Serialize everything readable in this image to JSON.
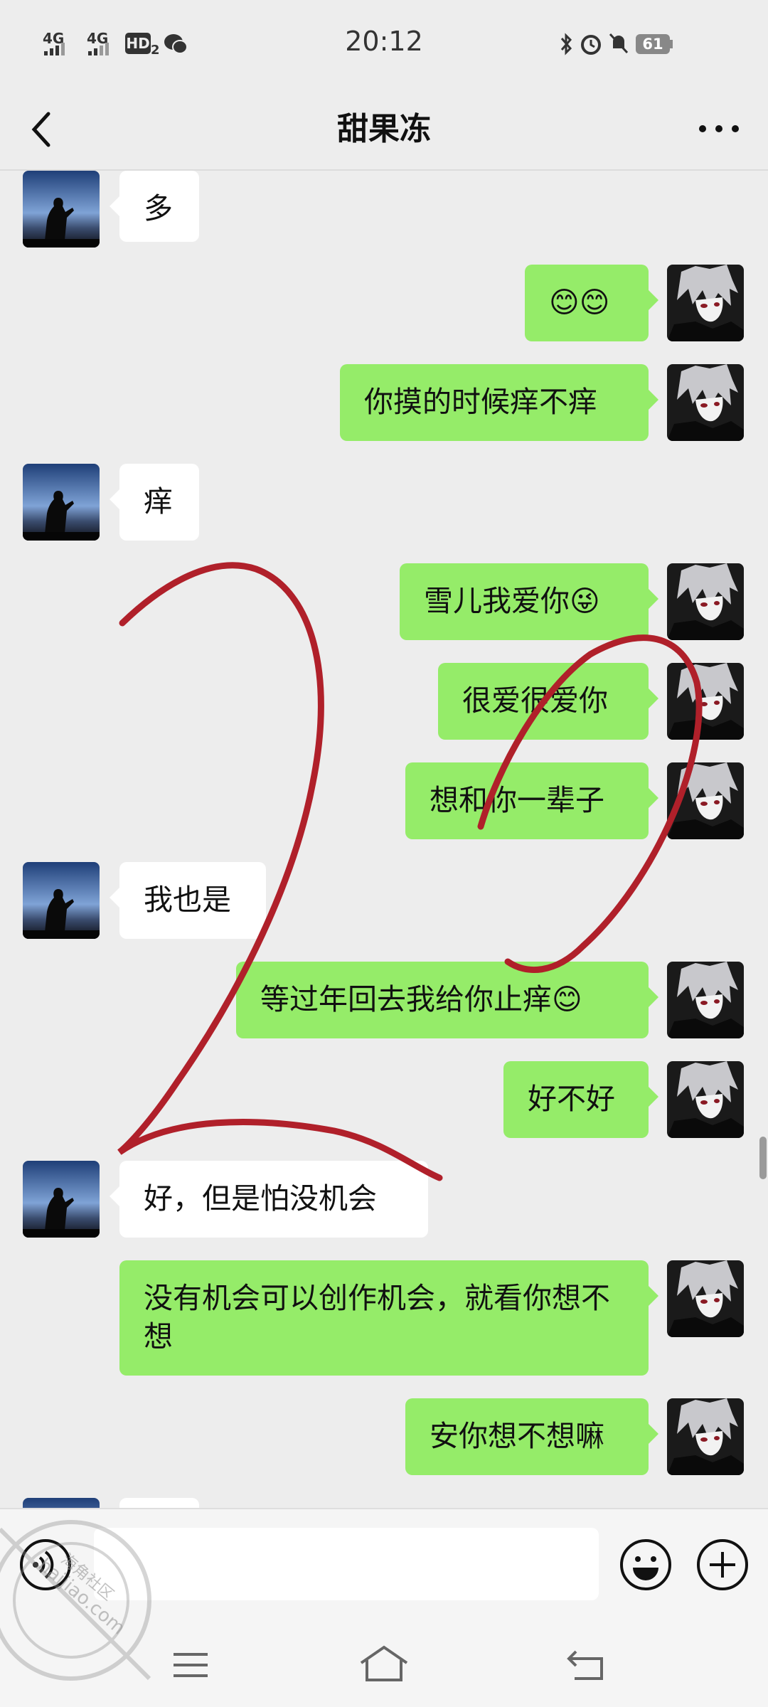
{
  "status_bar": {
    "signal1": "4G",
    "signal2": "4G",
    "hd": "HD",
    "hd_sub": "2",
    "time": "20:12",
    "battery": "61"
  },
  "header": {
    "title": "甜果冻"
  },
  "messages": [
    {
      "side": "in",
      "text": "多"
    },
    {
      "side": "out",
      "text": "😊😊"
    },
    {
      "side": "out",
      "text": "你摸的时候痒不痒"
    },
    {
      "side": "in",
      "text": "痒"
    },
    {
      "side": "out",
      "text": "雪儿我爱你😜"
    },
    {
      "side": "out",
      "text": "很爱很爱你"
    },
    {
      "side": "out",
      "text": "想和你一辈子"
    },
    {
      "side": "in",
      "text": "我也是"
    },
    {
      "side": "out",
      "text": "等过年回去我给你止痒😊"
    },
    {
      "side": "out",
      "text": "好不好"
    },
    {
      "side": "in",
      "text": "好，但是怕没机会"
    },
    {
      "side": "out",
      "text": "没有机会可以创作机会，就看你想不想"
    },
    {
      "side": "out",
      "text": "安你想不想嘛"
    }
  ],
  "watermark": {
    "text": "haijiao.com",
    "text_cn": "海角社区"
  },
  "colors": {
    "background": "#ededed",
    "bubble_out": "#95ec69",
    "bubble_in": "#ffffff",
    "annotation": "#b0202a"
  }
}
